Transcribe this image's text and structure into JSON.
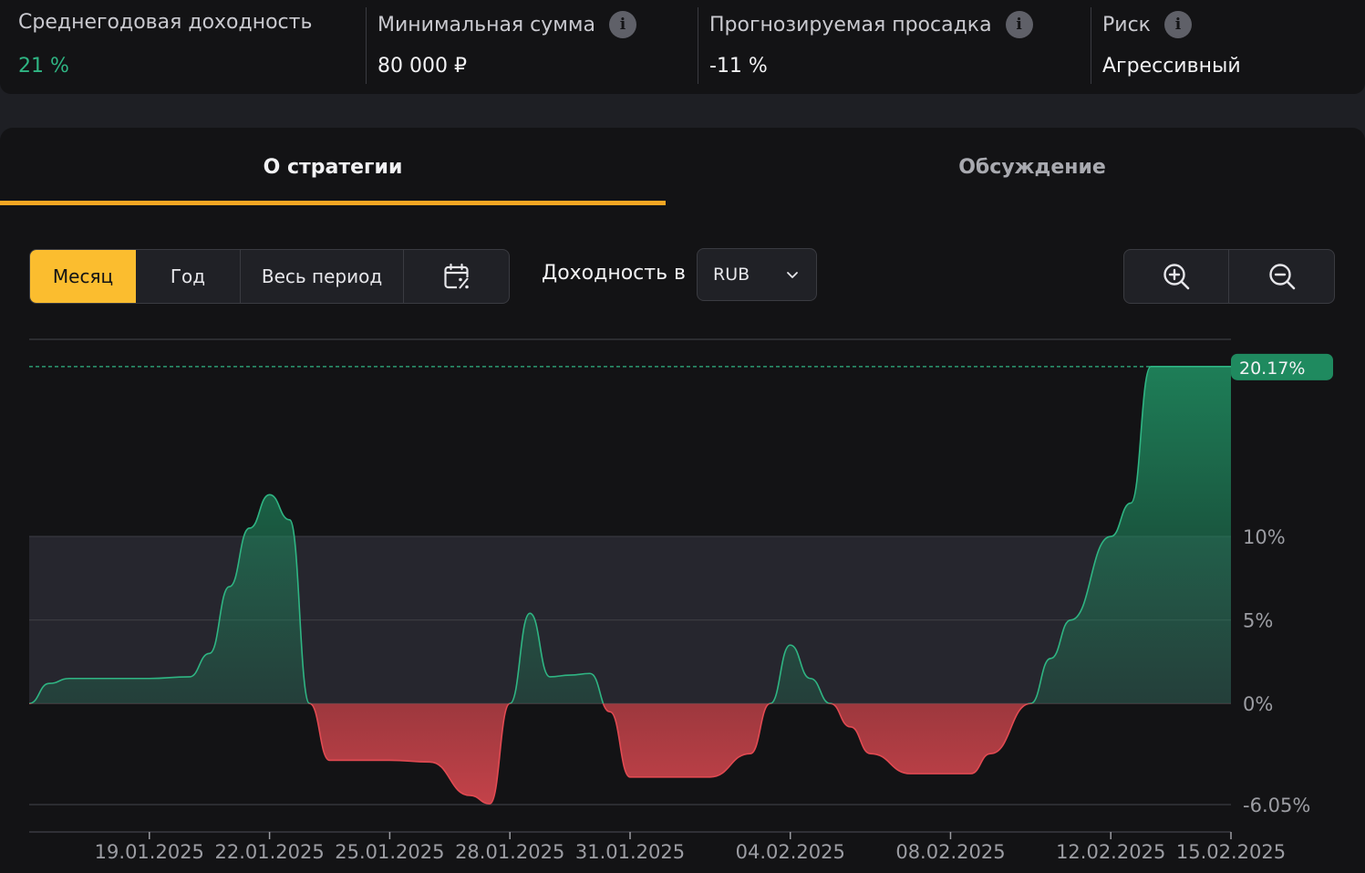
{
  "stats": [
    {
      "label": "Среднегодовая доходность",
      "value": "21 %",
      "value_color": "#2fb583",
      "info": false
    },
    {
      "label": "Минимальная сумма",
      "value": "80 000 ₽",
      "info": true
    },
    {
      "label": "Прогнозируемая просадка",
      "value": "-11 %",
      "info": true
    },
    {
      "label": "Риск",
      "value": "Агрессивный",
      "info": true
    }
  ],
  "tabs": [
    {
      "label": "О стратегии",
      "active": true
    },
    {
      "label": "Обсуждение",
      "active": false
    }
  ],
  "period_buttons": [
    {
      "label": "Месяц",
      "active": true
    },
    {
      "label": "Год",
      "active": false
    },
    {
      "label": "Весь период",
      "active": false
    }
  ],
  "calendar_icon": "calendar-percent-icon",
  "currency": {
    "label": "Доходность в",
    "selected": "RUB"
  },
  "zoom": {
    "in_icon": "zoom-in-icon",
    "out_icon": "zoom-out-icon"
  },
  "colors": {
    "accent": "#fbbd2f",
    "tab_underline": "#f5a623",
    "positive": "#2fb583",
    "negative": "#e24a52",
    "current_badge": "#1f8a5f"
  },
  "chart_data": {
    "type": "area",
    "y_unit": "%",
    "ylim": [
      -6.05,
      21.8
    ],
    "y_ticks": [
      {
        "value": 10,
        "label": "10%"
      },
      {
        "value": 5,
        "label": "5%"
      },
      {
        "value": 0,
        "label": "0%"
      },
      {
        "value": -6.05,
        "label": "-6.05%"
      }
    ],
    "x_range": [
      "16.01.2025",
      "15.02.2025"
    ],
    "x_ticks": [
      "19.01.2025",
      "22.01.2025",
      "25.01.2025",
      "28.01.2025",
      "31.01.2025",
      "04.02.2025",
      "08.02.2025",
      "12.02.2025",
      "15.02.2025"
    ],
    "current_value": 20.17,
    "current_label": "20.17%",
    "grid": true,
    "series": [
      {
        "x": [
          "16.01.2025",
          "16.01.2025",
          "17.01.2025",
          "18.01.2025",
          "19.01.2025",
          "20.01.2025",
          "20.01.2025",
          "21.01.2025",
          "21.01.2025",
          "22.01.2025",
          "22.01.2025",
          "23.01.2025",
          "23.01.2025",
          "24.01.2025",
          "25.01.2025",
          "26.01.2025",
          "27.01.2025",
          "27.01.2025",
          "28.01.2025",
          "28.01.2025",
          "29.01.2025",
          "29.01.2025",
          "30.01.2025",
          "30.01.2025",
          "31.01.2025",
          "01.02.2025",
          "02.02.2025",
          "03.02.2025",
          "03.02.2025",
          "04.02.2025",
          "04.02.2025",
          "05.02.2025",
          "05.02.2025",
          "06.02.2025",
          "07.02.2025",
          "08.02.2025",
          "08.02.2025",
          "09.02.2025",
          "10.02.2025",
          "10.02.2025",
          "11.02.2025",
          "12.02.2025",
          "12.02.2025",
          "13.02.2025",
          "13.02.2025",
          "14.02.2025",
          "14.02.2025",
          "15.02.2025"
        ],
        "y": [
          0.0,
          1.2,
          1.5,
          1.5,
          1.5,
          1.6,
          3.0,
          7.0,
          10.5,
          12.5,
          11.0,
          0.0,
          -3.4,
          -3.4,
          -3.4,
          -3.5,
          -5.5,
          -6.0,
          0.0,
          5.4,
          1.6,
          1.7,
          1.8,
          -0.5,
          -4.4,
          -4.4,
          -4.4,
          -3.0,
          0.0,
          3.5,
          1.5,
          0.0,
          -1.4,
          -3.0,
          -4.2,
          -4.2,
          -4.2,
          -3.0,
          0.0,
          2.7,
          5.0,
          10.0,
          12.0,
          20.17,
          20.17,
          20.17,
          20.17,
          20.17
        ]
      }
    ]
  }
}
